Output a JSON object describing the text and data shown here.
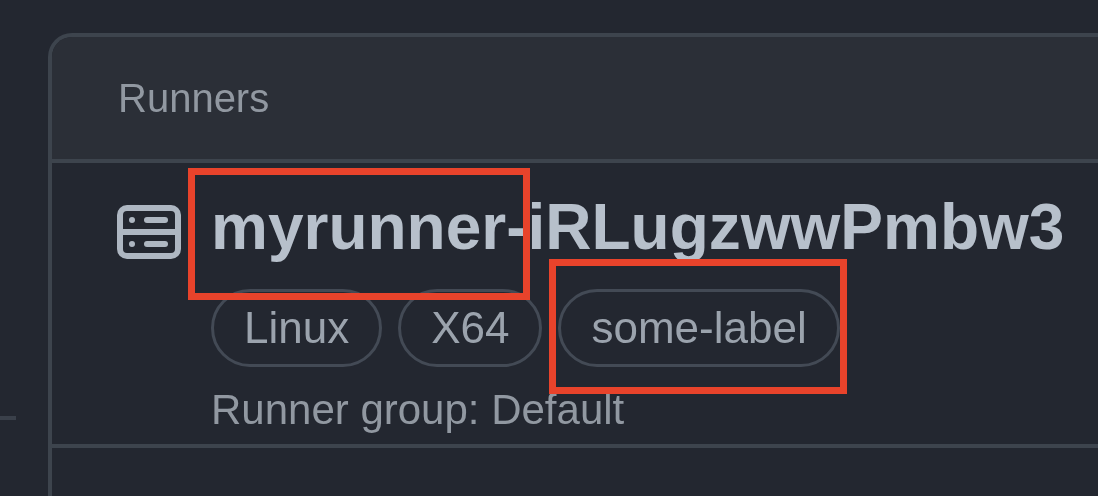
{
  "panel": {
    "title": "Runners"
  },
  "runners": [
    {
      "name": "myrunner-iRLugzwwPmbw3",
      "name_highlighted": true,
      "labels": [
        {
          "text": "Linux",
          "highlighted": false
        },
        {
          "text": "X64",
          "highlighted": false
        },
        {
          "text": "some-label",
          "highlighted": true
        }
      ],
      "group": "Runner group: Default"
    }
  ]
}
